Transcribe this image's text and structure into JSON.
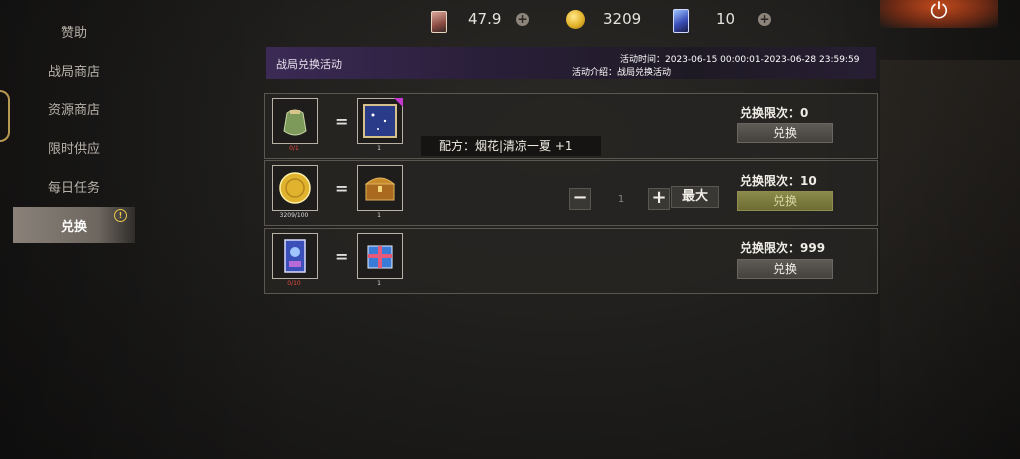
{
  "colors": {
    "accent_purple": "#3b2a55",
    "active_button": "#7d7b3f",
    "alert": "#e9c94d"
  },
  "menu": {
    "items": [
      {
        "label": "赞助",
        "active": false
      },
      {
        "label": "战局商店",
        "active": false
      },
      {
        "label": "资源商店",
        "active": false
      },
      {
        "label": "限时供应",
        "active": false
      },
      {
        "label": "每日任务",
        "active": false
      },
      {
        "label": "兑换",
        "active": true,
        "alert": "!"
      }
    ]
  },
  "resources": [
    {
      "icon": "card-icon",
      "value": "47.9"
    },
    {
      "icon": "coin-icon",
      "value": "3209"
    },
    {
      "icon": "ticket-icon",
      "value": "10"
    }
  ],
  "power_icon": "⏻",
  "banner": {
    "title": "战局兑换活动",
    "time": "活动时间：2023-06-15 00:00:01-2023-06-28 23:59:59",
    "desc": "活动介绍：战局兑换活动"
  },
  "rows": [
    {
      "input_icon": "pouch-icon",
      "input_caption": "0/1",
      "output_icon": "blue-frame-icon",
      "output_caption": "1",
      "equals": "=",
      "limit": "兑换限次：0",
      "button": "兑换",
      "recipe": "配方：烟花|清凉一夏  +1"
    },
    {
      "input_icon": "gold-coin-icon",
      "input_caption": "3209/100",
      "output_icon": "treasure-chest-icon",
      "output_caption": "1",
      "equals": "=",
      "limit": "兑换限次：10",
      "button": "兑换",
      "stepper": {
        "minus": "−",
        "value": "1",
        "plus": "+",
        "max": "最大"
      }
    },
    {
      "input_icon": "ticket-card-icon",
      "input_caption": "0/10",
      "output_icon": "gift-box-icon",
      "output_caption": "1",
      "equals": "=",
      "limit": "兑换限次：999",
      "button": "兑换"
    }
  ]
}
